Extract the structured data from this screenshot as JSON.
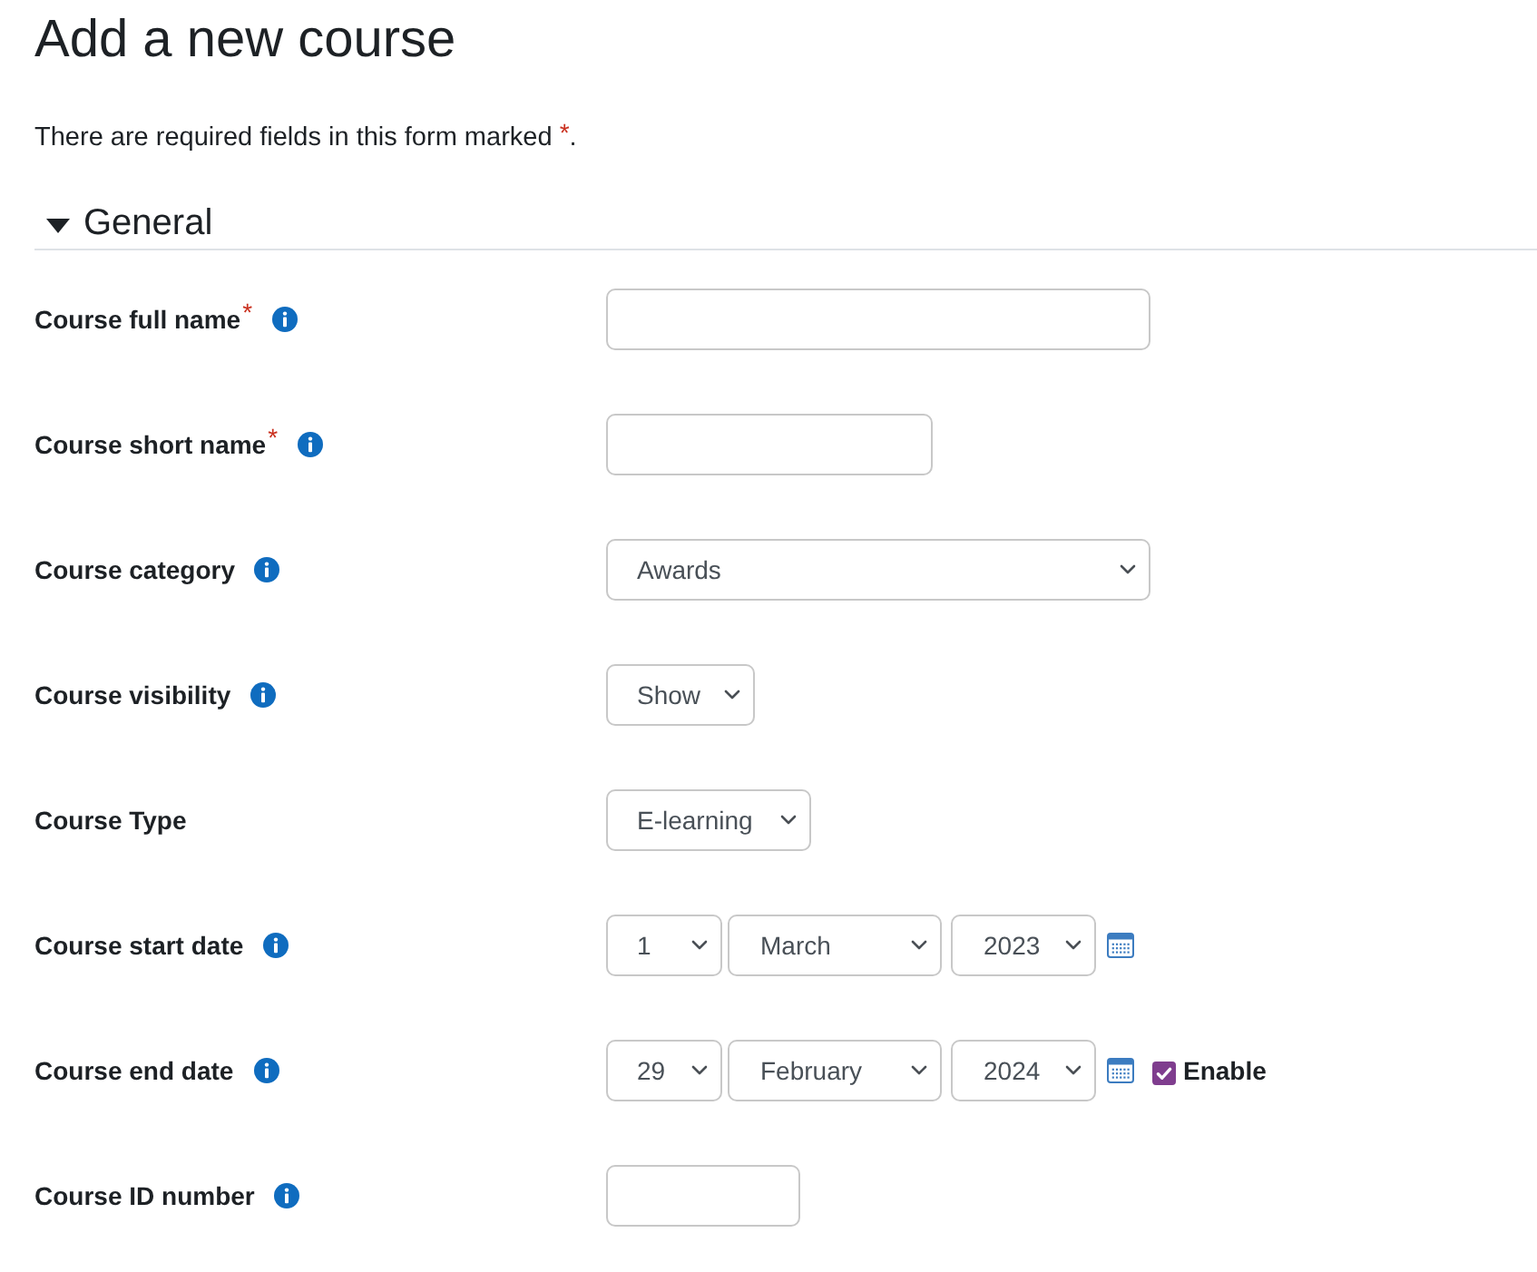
{
  "page_title": "Add a new course",
  "required_notice": {
    "text": "There are required fields in this form marked",
    "marker": "*",
    "end": "."
  },
  "section": {
    "title": "General",
    "expanded": true
  },
  "fields": [
    {
      "label": "Course full name",
      "required_mark": "*",
      "help": true,
      "kind": "text"
    },
    {
      "label": "Course short name",
      "required_mark": "*",
      "help": true,
      "kind": "text"
    },
    {
      "label": "Course category",
      "help": true,
      "kind": "select",
      "value": "Awards"
    },
    {
      "label": "Course visibility",
      "help": true,
      "kind": "select",
      "value": "Show"
    },
    {
      "label": "Course Type",
      "help": false,
      "kind": "select",
      "value": "E-learning"
    },
    {
      "label": "Course start date",
      "help": true,
      "kind": "date",
      "day": "1",
      "month": "March",
      "year": "2023"
    },
    {
      "label": "Course end date",
      "help": true,
      "kind": "date",
      "day": "29",
      "month": "February",
      "year": "2024",
      "enable": {
        "label": "Enable",
        "checked": true
      }
    },
    {
      "label": "Course ID number",
      "help": true,
      "kind": "text"
    }
  ]
}
